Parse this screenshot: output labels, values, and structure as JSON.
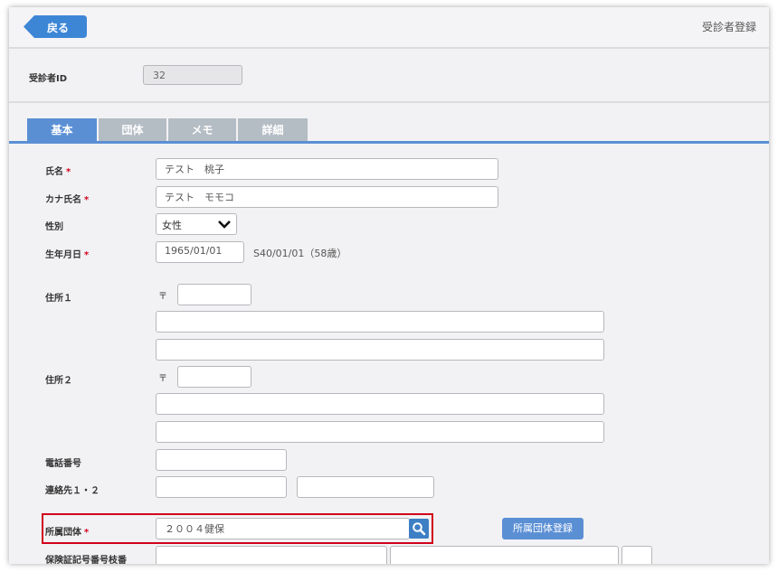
{
  "header": {
    "back_label": "戻る",
    "title": "受診者登録"
  },
  "patient_id": {
    "label": "受診者ID",
    "value": "32"
  },
  "tabs": [
    {
      "label": "基本",
      "active": true
    },
    {
      "label": "団体",
      "active": false
    },
    {
      "label": "メモ",
      "active": false
    },
    {
      "label": "詳細",
      "active": false
    }
  ],
  "form": {
    "name": {
      "label": "氏名",
      "required": "*",
      "value": "テスト　桃子"
    },
    "kana": {
      "label": "カナ氏名",
      "required": "*",
      "value": "テスト　モモコ"
    },
    "gender": {
      "label": "性別",
      "value": "女性"
    },
    "birthdate": {
      "label": "生年月日",
      "required": "*",
      "value": "1965/01/01",
      "wareki": "S40/01/01（58歳）"
    },
    "address1": {
      "label": "住所１",
      "postal_mark": "〒",
      "postal": "",
      "line1": "",
      "line2": ""
    },
    "address2": {
      "label": "住所２",
      "postal_mark": "〒",
      "postal": "",
      "line1": "",
      "line2": ""
    },
    "phone": {
      "label": "電話番号",
      "value": ""
    },
    "contact": {
      "label": "連絡先１・２",
      "value1": "",
      "value2": ""
    },
    "group": {
      "label": "所属団体",
      "required": "*",
      "value": "２００４健保",
      "register_label": "所属団体登録"
    },
    "insurance": {
      "label": "保険証記号番号枝番"
    }
  },
  "colors": {
    "accent": "#5b8fd4",
    "tab_inactive": "#b4bcc4",
    "required": "#d0021b",
    "highlight": "#d0021b"
  }
}
